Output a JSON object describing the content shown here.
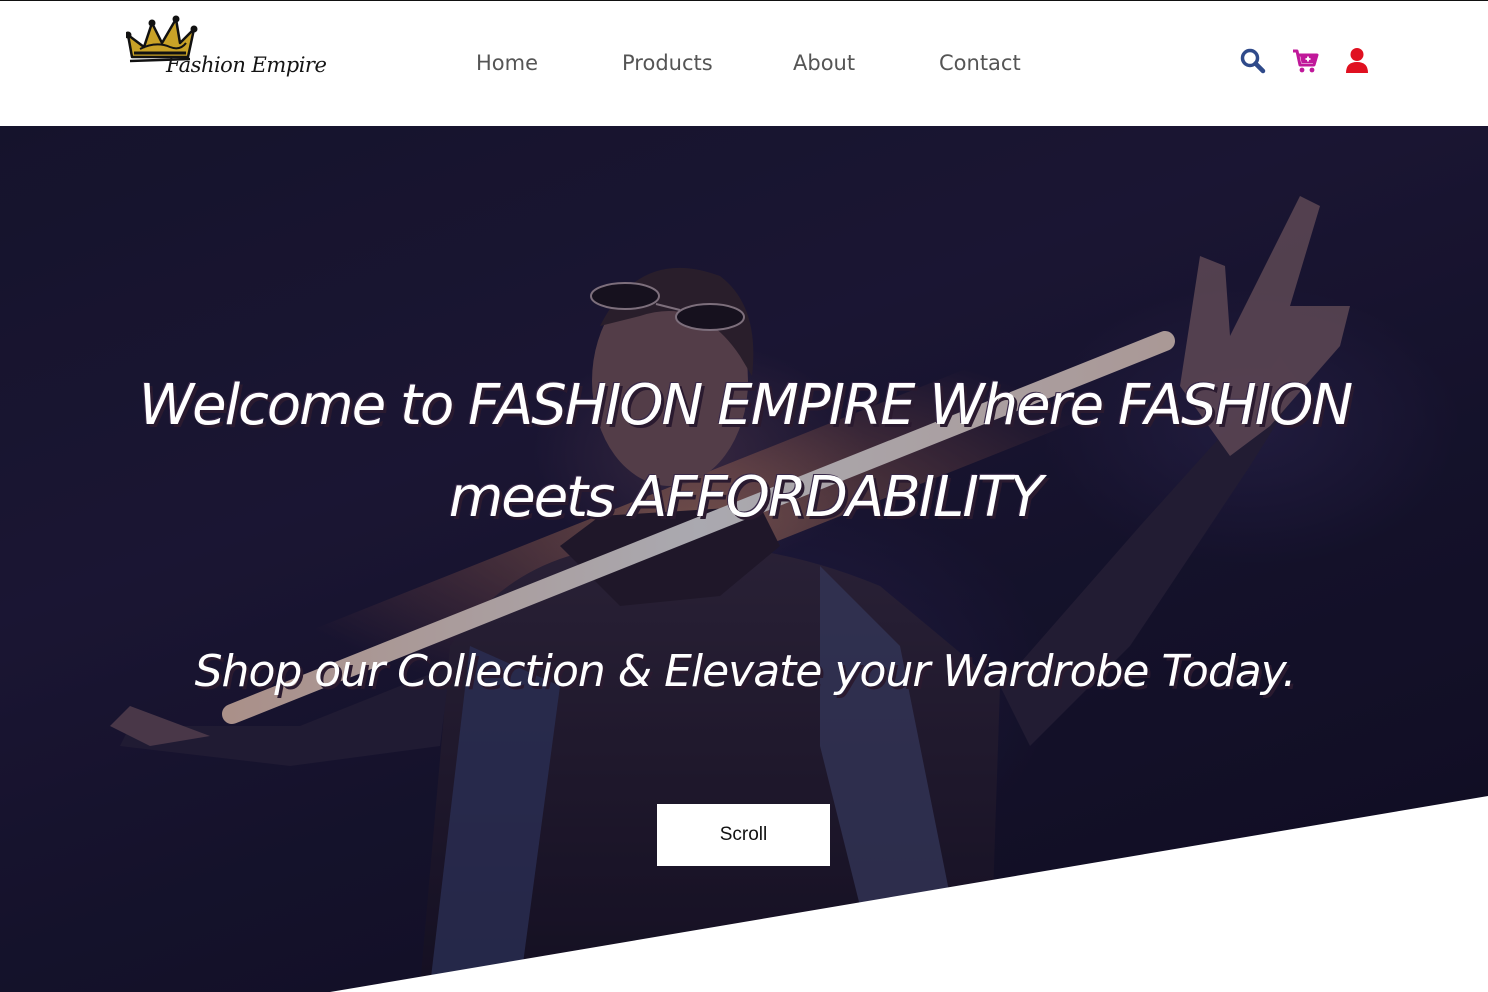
{
  "brand": {
    "logo_text": "Fashion Empire",
    "logo_colors": {
      "crown": "#c9a227",
      "crown_outline": "#111111",
      "text": "#141414"
    }
  },
  "nav": {
    "links": [
      {
        "label": "Home"
      },
      {
        "label": "Products"
      },
      {
        "label": "About"
      },
      {
        "label": "Contact"
      }
    ],
    "icons": [
      {
        "name": "search-icon",
        "color": "#2f4a8a"
      },
      {
        "name": "cart-icon",
        "color": "#c0189a"
      },
      {
        "name": "user-icon",
        "color": "#e01020"
      }
    ]
  },
  "hero": {
    "title": "Welcome to FASHION EMPIRE Where FASHION meets AFFORDABILITY",
    "subtitle": "Shop our Collection & Elevate your Wardrobe Today.",
    "scroll_label": "Scroll"
  }
}
